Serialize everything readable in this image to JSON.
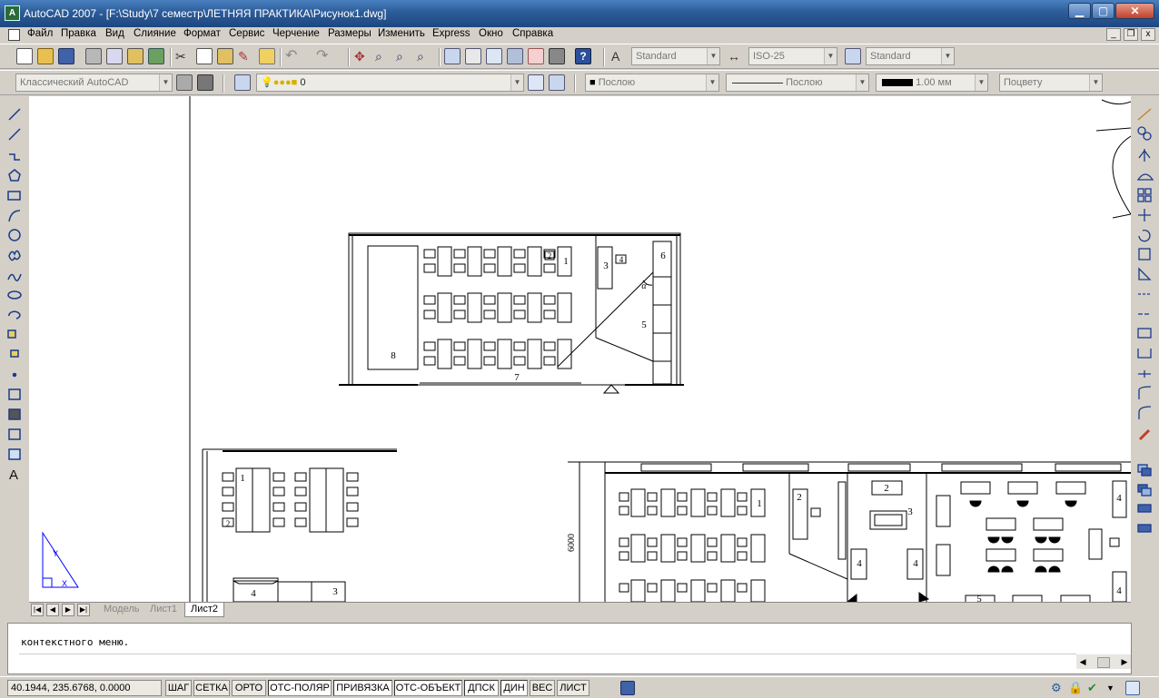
{
  "window": {
    "app_icon": "A",
    "title": "AutoCAD 2007 - [F:\\Study\\7 семестр\\ЛЕТНЯЯ ПРАКТИКА\\Рисунок1.dwg]",
    "min_glyph": "▁",
    "max_glyph": "▢",
    "close_glyph": "✕"
  },
  "menu": {
    "items": [
      "Файл",
      "Правка",
      "Вид",
      "Слияние",
      "Формат",
      "Сервис",
      "Черчение",
      "Размеры",
      "Изменить",
      "Express",
      "Окно",
      "Справка"
    ],
    "doc_min": "_",
    "doc_restore": "❐",
    "doc_close": "x"
  },
  "toolbars": {
    "text_style": "Standard",
    "dim_style": "ISO-25",
    "table_style": "Standard",
    "workspace": "Классический AutoCAD",
    "layer": "0",
    "color": "Послою",
    "linetype": "Послою",
    "lineweight": "1.00 мм",
    "plotstyle": "Поцвету"
  },
  "drawing": {
    "room1": {
      "labels": [
        "1",
        "2",
        "3",
        "4",
        "5",
        "6",
        "7",
        "8"
      ],
      "angle_label": "α"
    },
    "room2": {
      "labels": [
        "1",
        "2",
        "3",
        "4"
      ]
    },
    "room3": {
      "dim": "6000",
      "labels": [
        "1",
        "2",
        "3",
        "4",
        "4",
        "4",
        "4",
        "5"
      ]
    },
    "ucs_x": "X",
    "ucs_y": "Y"
  },
  "layout_tabs": {
    "tabs": [
      "Модель",
      "Лист1",
      "Лист2"
    ],
    "active": "Лист2",
    "nav": [
      "|◀",
      "◀",
      "▶",
      "▶|"
    ]
  },
  "command": {
    "history": "контекстного меню.",
    "input": "",
    "scroll_left": "◀",
    "scroll_right": "▶"
  },
  "status": {
    "coordinates": "40.1944, 235.6768, 0.0000",
    "toggles": [
      {
        "label": "ШАГ",
        "on": false
      },
      {
        "label": "СЕТКА",
        "on": false
      },
      {
        "label": "ОРТО",
        "on": false
      },
      {
        "label": "ОТС-ПОЛЯР",
        "on": true
      },
      {
        "label": "ПРИВЯЗКА",
        "on": true
      },
      {
        "label": "ОТС-ОБЪЕКТ",
        "on": true
      },
      {
        "label": "ДПСК",
        "on": true
      },
      {
        "label": "ДИН",
        "on": true
      },
      {
        "label": "ВЕС",
        "on": false
      },
      {
        "label": "ЛИСТ",
        "on": false
      }
    ]
  },
  "colors": {
    "titlebar": "#2c5c99",
    "canvas": "#ffffff",
    "chrome": "#d4d0c8"
  }
}
